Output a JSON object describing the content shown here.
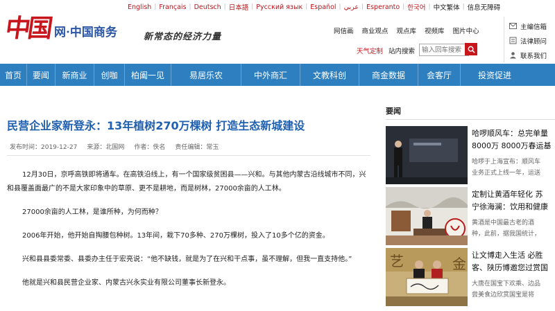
{
  "lang_bar": {
    "items": [
      "English",
      "Français",
      "Deutsch",
      "日本語",
      "Русский язык",
      "Español",
      "عربي",
      "Esperanto",
      "한국어"
    ],
    "dark_items": [
      "中文繁体",
      "信息无障碍"
    ]
  },
  "header": {
    "logo_mark": "中国",
    "logo_text": "网·中国商务",
    "slogan": "新常态的经济力量",
    "top_links": [
      "网信画",
      "商业观点",
      "观点库",
      "视频库",
      "图片中心"
    ],
    "weather": "天气定制",
    "search_label": "站内搜索",
    "search_placeholder": "输入回车搜索",
    "side_links": [
      "主编信箱",
      "法律顾问",
      "联系我们"
    ]
  },
  "nav": [
    {
      "label": "首页",
      "w": 38
    },
    {
      "label": "要闻",
      "w": 40
    },
    {
      "label": "新商业",
      "w": 55
    },
    {
      "label": "创咖",
      "w": 43
    },
    {
      "label": "柏阖一见",
      "w": 66
    },
    {
      "label": "易居乐农",
      "w": 100
    },
    {
      "label": "中外商汇",
      "w": 84
    },
    {
      "label": "文教科创",
      "w": 84
    },
    {
      "label": "商金数据",
      "w": 84
    },
    {
      "label": "会客厅",
      "w": 60
    },
    {
      "label": "投资促进",
      "w": 98
    }
  ],
  "article": {
    "title": "民营企业家新登永：13年植树270万棵树 打造生态新城建设",
    "meta": {
      "date": "发布时间：2019-12-27",
      "source": "来源：北国网",
      "author": "作者：佚名",
      "editor": "责任编辑：常玉"
    },
    "paragraphs": [
      "12月30日，京呼高铁即将通车。在高铁沿线上，有一个国家级贫困县——兴和。与其他内蒙古沿线城市不同，兴和县覆盖面最广的不是大家印象中的草原、更不是耕地，而是树林，27000余亩的人工林。",
      "27000余亩的人工林，是谁所种，为何而种？",
      "2006年开始，他开始自掏腰包种树。13年间，栽下70多种、270万棵树，投入了10多个亿的资金。",
      "兴和县县委常委、县委办主任于宏亮说：“他不缺钱，就是为了在兴和干点事，虽不理解，但我一直支持他。”",
      "他就是兴和县民营企业家、内蒙古兴永实业有限公司董事长新登永。"
    ]
  },
  "sidebar": {
    "title": "要闻",
    "news": [
      {
        "title": "哈啰顺风车：总完单量",
        "title2": "8000万 8000万春运基",
        "summary": "哈啰于上海宣布：顺风车",
        "summary2": "业务正式上线一年，运送"
      },
      {
        "title": "定制让黄酒年轻化 苏",
        "title2": "宁徐海澜：饮用和健康",
        "summary": "黄酒是中国最古老的酒",
        "summary2": "种，此前，据我国统计，"
      },
      {
        "title": "让文博走入生活 必胜",
        "title2": "客、陕历博邀您过赏国",
        "summary": "大唐在国宝下欢乘、边品",
        "summary2": "尝美食边欣赏国宝是将"
      }
    ]
  },
  "colors": {
    "brand_red": "#c8161d",
    "nav_blue": "#2e7fc0",
    "headline_blue": "#2060b0"
  }
}
